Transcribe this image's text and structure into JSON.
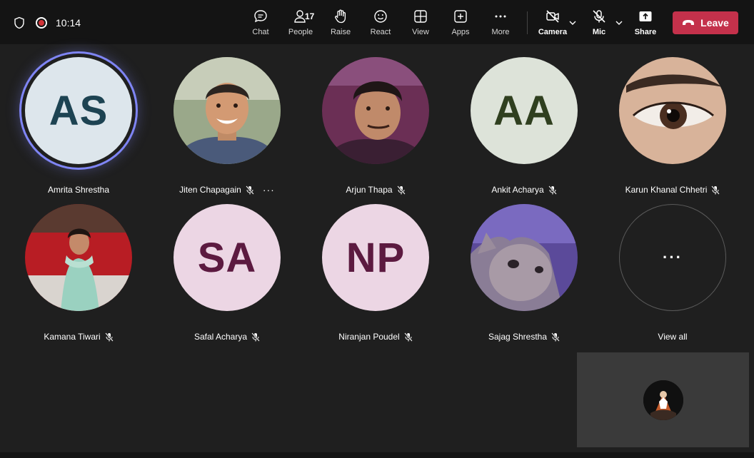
{
  "status": {
    "time": "10:14",
    "shield_icon": "shield-icon",
    "recording_icon": "recording-icon"
  },
  "toolbar": {
    "chat_label": "Chat",
    "people_label": "People",
    "people_count": "17",
    "raise_label": "Raise",
    "react_label": "React",
    "view_label": "View",
    "apps_label": "Apps",
    "more_label": "More",
    "camera_label": "Camera",
    "mic_label": "Mic",
    "share_label": "Share",
    "leave_label": "Leave"
  },
  "colors": {
    "leave": "#c4314b",
    "active_speaker_ring": "#7f85f5",
    "background": "#1f1f1f",
    "topbar": "#141414"
  },
  "participants": [
    {
      "name": "Amrita Shrestha",
      "initials": "AS",
      "avatar": "initials",
      "bg": "#dde6ec",
      "fg": "#1d4352",
      "active": true,
      "muted": false
    },
    {
      "name": "Jiten Chapagain",
      "initials": "",
      "avatar": "photo-person-smiling",
      "muted": true,
      "more": "···"
    },
    {
      "name": "Arjun Thapa",
      "initials": "",
      "avatar": "photo-person-selfie",
      "muted": true
    },
    {
      "name": "Ankit Acharya",
      "initials": "AA",
      "avatar": "initials",
      "bg": "#dde3d9",
      "fg": "#2f3f1f",
      "muted": true
    },
    {
      "name": "Karun Khanal Chhetri",
      "initials": "",
      "avatar": "photo-eye-closeup",
      "muted": true
    },
    {
      "name": "Kamana Tiwari",
      "initials": "",
      "avatar": "photo-person-red-sofa",
      "muted": true
    },
    {
      "name": "Safal Acharya",
      "initials": "SA",
      "avatar": "initials",
      "bg": "#ecd6e4",
      "fg": "#5c1a40",
      "muted": true
    },
    {
      "name": "Niranjan Poudel",
      "initials": "NP",
      "avatar": "initials",
      "bg": "#ecd6e4",
      "fg": "#5c1a40",
      "muted": true
    },
    {
      "name": "Sajag Shrestha",
      "initials": "",
      "avatar": "photo-cat",
      "muted": true
    }
  ],
  "view_all": {
    "label": "View all",
    "dots": "···"
  },
  "self_view": {
    "avatar": "photo-self-dark"
  }
}
